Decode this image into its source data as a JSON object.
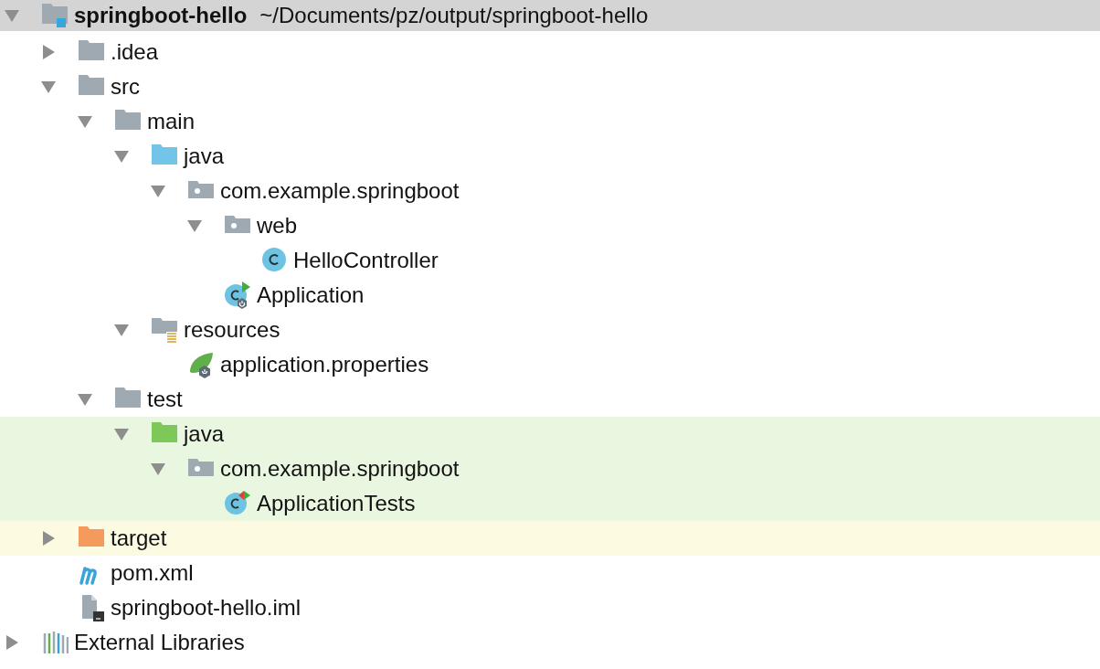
{
  "project_tree": [
    {
      "kind": "module",
      "label": "springboot-hello",
      "path": "~/Documents/pz/output/springboot-hello",
      "selected": true,
      "expanded": true,
      "children": [
        {
          "kind": "folder",
          "label": ".idea",
          "selected": false,
          "expanded": false
        },
        {
          "kind": "folder",
          "label": "src",
          "selected": false,
          "expanded": true,
          "children": [
            {
              "kind": "folder",
              "label": "main",
              "selected": false,
              "expanded": true,
              "children": [
                {
                  "kind": "source-folder",
                  "label": "java",
                  "selected": false,
                  "expanded": true,
                  "children": [
                    {
                      "kind": "package",
                      "label": "com.example.springboot",
                      "selected": false,
                      "expanded": true,
                      "children": [
                        {
                          "kind": "package",
                          "label": "web",
                          "selected": false,
                          "expanded": true,
                          "children": [
                            {
                              "kind": "class",
                              "label": "HelloController",
                              "selected": false
                            }
                          ]
                        },
                        {
                          "kind": "spring-class",
                          "label": "Application",
                          "selected": false
                        }
                      ]
                    }
                  ]
                },
                {
                  "kind": "resources-folder",
                  "label": "resources",
                  "selected": false,
                  "expanded": true,
                  "children": [
                    {
                      "kind": "spring-properties",
                      "label": "application.properties",
                      "selected": false
                    }
                  ]
                }
              ]
            },
            {
              "kind": "folder",
              "label": "test",
              "selected": false,
              "expanded": true,
              "children": [
                {
                  "kind": "test-folder",
                  "label": "java",
                  "selected": false,
                  "expanded": true,
                  "color": "#e9f7e1",
                  "children": [
                    {
                      "kind": "package",
                      "label": "com.example.springboot",
                      "selected": false,
                      "expanded": true,
                      "color": "#e9f7e1",
                      "children": [
                        {
                          "kind": "test-class",
                          "label": "ApplicationTests",
                          "selected": false,
                          "color": "#e9f7e1"
                        }
                      ]
                    }
                  ]
                }
              ]
            }
          ]
        },
        {
          "kind": "excluded-folder",
          "label": "target",
          "selected": false,
          "expanded": false,
          "color": "#fcfbe2"
        },
        {
          "kind": "maven",
          "label": "pom.xml",
          "selected": false
        },
        {
          "kind": "iml",
          "label": "springboot-hello.iml",
          "selected": false
        }
      ]
    },
    {
      "kind": "libraries",
      "label": "External Libraries",
      "selected": false,
      "expanded": false
    }
  ]
}
